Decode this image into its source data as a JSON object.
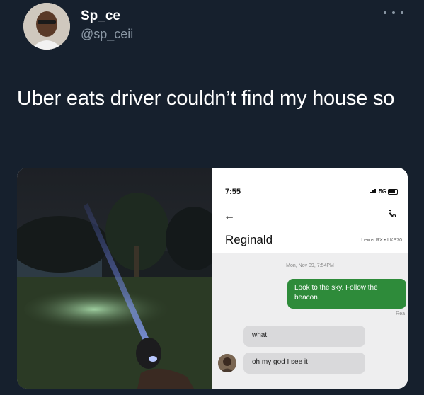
{
  "tweet": {
    "display_name": "Sp_ce",
    "handle": "@sp_ceii",
    "text": "Uber eats driver couldn’t find my house so",
    "more_icon": "more-horizontal-icon"
  },
  "chat": {
    "status_time": "7:55",
    "status_signal": "5G",
    "contact_name": "Reginald",
    "vehicle": "Lexus RX • LKS70",
    "timestamp": "Mon, Nov 09, 7:54PM",
    "messages": [
      {
        "from": "me",
        "text": "Look to the sky. Follow the beacon."
      },
      {
        "from": "driver",
        "text": "what"
      },
      {
        "from": "driver",
        "text": "oh my god I see it"
      }
    ],
    "read_label": "Rea"
  },
  "colors": {
    "background": "#16202d",
    "sent_bubble": "#2e8b3a",
    "received_bubble": "#d9d9db"
  }
}
